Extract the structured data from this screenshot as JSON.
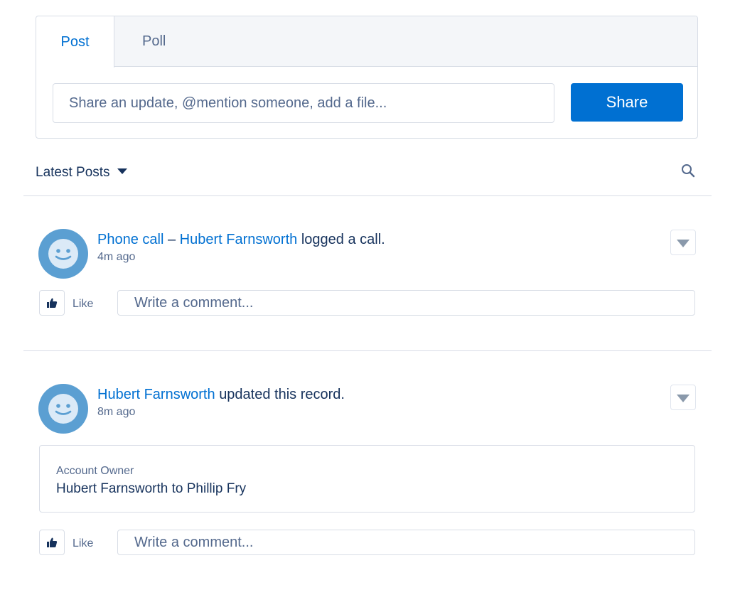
{
  "publisher": {
    "tabs": [
      "Post",
      "Poll"
    ],
    "input_placeholder": "Share an update, @mention someone, add a file...",
    "share_label": "Share"
  },
  "feed": {
    "sort_label": "Latest Posts"
  },
  "posts": [
    {
      "actor_link_1": "Phone call",
      "separator": "–",
      "actor_link_2": "Hubert Farnsworth",
      "action": "logged a call.",
      "time": "4m ago",
      "like_label": "Like",
      "comment_placeholder": "Write a comment..."
    },
    {
      "actor_link": "Hubert Farnsworth",
      "action": "updated this record.",
      "time": "8m ago",
      "change_field": "Account Owner",
      "change_value": "Hubert Farnsworth to Phillip Fry",
      "like_label": "Like",
      "comment_placeholder": "Write a comment..."
    }
  ],
  "colors": {
    "brand": "#0070d2",
    "text": "#16325c",
    "muted": "#54698d",
    "border": "#d8dde6",
    "avatar": "#5b9fd2"
  },
  "icons": [
    "search-icon",
    "dropdown-caret-icon",
    "smiley-avatar-icon",
    "thumbs-up-icon",
    "menu-chevron-icon"
  ]
}
